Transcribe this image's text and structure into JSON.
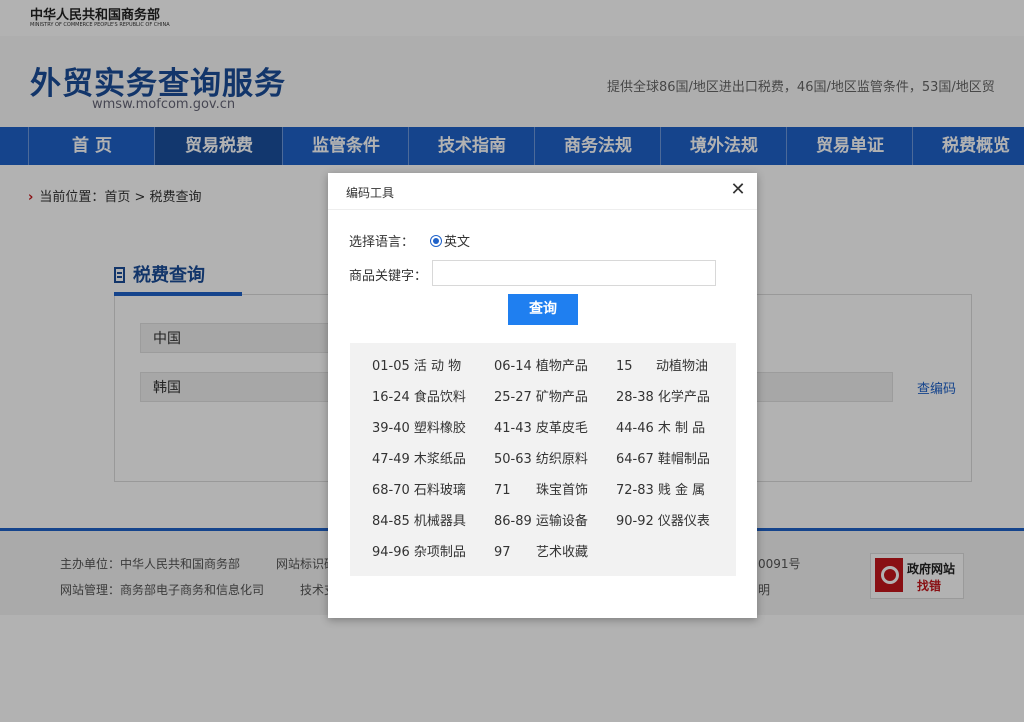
{
  "page": {
    "ministry_cn": "中华人民共和国商务部",
    "ministry_en": "MINISTRY OF COMMERCE PEOPLE'S REPUBLIC OF CHINA",
    "site_title": "外贸实务查询服务",
    "site_url": "wmsw.mofcom.gov.cn",
    "tagline": "提供全球86国/地区进出口税费，46国/地区监管条件，53国/地区贸",
    "nav": [
      "首 页",
      "贸易税费",
      "监管条件",
      "技术指南",
      "商务法规",
      "境外法规",
      "贸易单证",
      "税费概览"
    ],
    "breadcrumb": "当前位置：首页 > 税费查询",
    "section_title": "税费查询",
    "country_from": "中国",
    "country_to": "韩国",
    "lookup_code_link": "查编码",
    "footer": {
      "sponsor": "主办单位：中华人民共和国商务部",
      "site_id": "网站标识码",
      "icp_tail": "0091号",
      "management": "网站管理：商务部电子商务和信息化司",
      "tech": "技术支",
      "explain_tail": "明",
      "gov_badge_line1": "政府网站",
      "gov_badge_line2": "找错"
    }
  },
  "modal": {
    "title": "编码工具",
    "close_symbol": "✕",
    "language_label": "选择语言：",
    "language_option": "英文",
    "keyword_label": "商品关键字：",
    "keyword_value": "",
    "query_button": "查询",
    "categories": [
      {
        "code": "01-05",
        "name": "活 动 物"
      },
      {
        "code": "06-14",
        "name": "植物产品"
      },
      {
        "code": "15",
        "name": "动植物油"
      },
      {
        "code": "16-24",
        "name": "食品饮料"
      },
      {
        "code": "25-27",
        "name": "矿物产品"
      },
      {
        "code": "28-38",
        "name": "化学产品"
      },
      {
        "code": "39-40",
        "name": "塑料橡胶"
      },
      {
        "code": "41-43",
        "name": "皮革皮毛"
      },
      {
        "code": "44-46",
        "name": "木 制 品"
      },
      {
        "code": "47-49",
        "name": "木浆纸品"
      },
      {
        "code": "50-63",
        "name": "纺织原料"
      },
      {
        "code": "64-67",
        "name": "鞋帽制品"
      },
      {
        "code": "68-70",
        "name": "石料玻璃"
      },
      {
        "code": "71",
        "name": "珠宝首饰"
      },
      {
        "code": "72-83",
        "name": "贱 金 属"
      },
      {
        "code": "84-85",
        "name": "机械器具"
      },
      {
        "code": "86-89",
        "name": "运输设备"
      },
      {
        "code": "90-92",
        "name": "仪器仪表"
      },
      {
        "code": "94-96",
        "name": "杂项制品"
      },
      {
        "code": "97",
        "name": "艺术收藏"
      }
    ]
  }
}
